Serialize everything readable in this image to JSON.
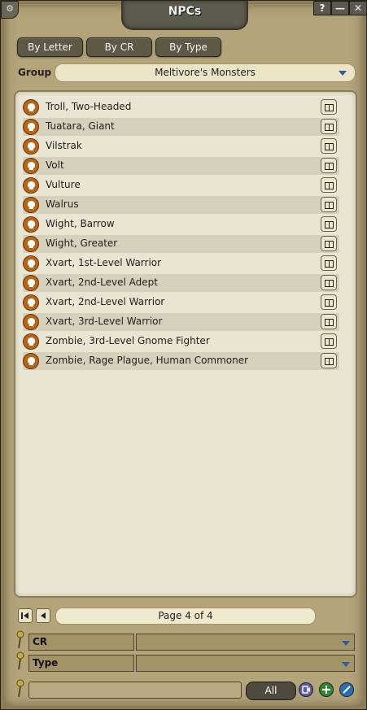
{
  "window": {
    "title": "NPCs",
    "buttons": {
      "help": "?",
      "minimize": "—",
      "close": "✕"
    }
  },
  "tabs": [
    {
      "label": "By Letter"
    },
    {
      "label": "By CR"
    },
    {
      "label": "By Type"
    }
  ],
  "group": {
    "label": "Group",
    "value": "Meltivore's Monsters"
  },
  "list": {
    "items": [
      {
        "name": "Troll, Two-Headed"
      },
      {
        "name": "Tuatara, Giant"
      },
      {
        "name": "Vilstrak"
      },
      {
        "name": "Volt"
      },
      {
        "name": "Vulture"
      },
      {
        "name": "Walrus"
      },
      {
        "name": "Wight, Barrow"
      },
      {
        "name": "Wight, Greater"
      },
      {
        "name": "Xvart, 1st-Level Warrior"
      },
      {
        "name": "Xvart, 2nd-Level Adept"
      },
      {
        "name": "Xvart, 2nd-Level Warrior"
      },
      {
        "name": "Xvart, 3rd-Level Warrior"
      },
      {
        "name": "Zombie, 3rd-Level Gnome Fighter"
      },
      {
        "name": "Zombie, Rage Plague, Human Commoner"
      }
    ]
  },
  "pagination": {
    "text": "Page 4 of 4"
  },
  "filters": [
    {
      "label": "CR",
      "value": ""
    },
    {
      "label": "Type",
      "value": ""
    }
  ],
  "search": {
    "value": "",
    "all_label": "All"
  },
  "colors": {
    "accent_blue": "#2e5e9c",
    "add_green": "#2f8a2f",
    "skull_orange": "#b8651c"
  }
}
